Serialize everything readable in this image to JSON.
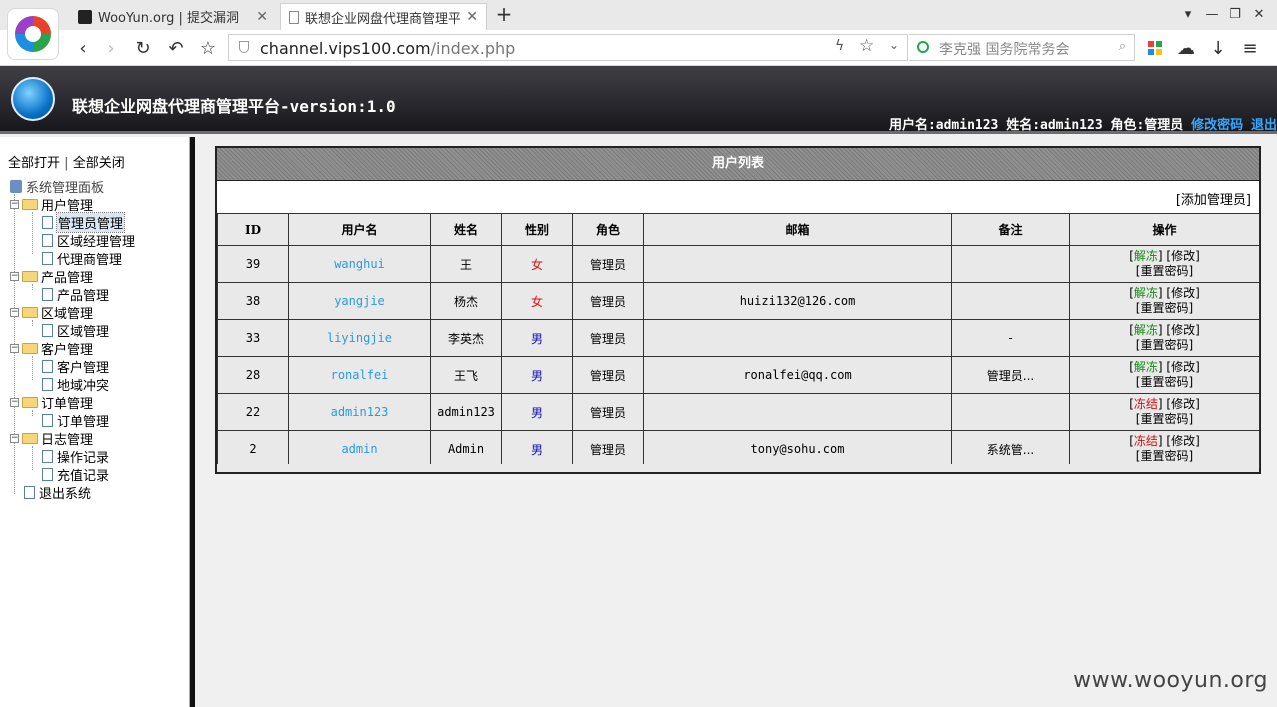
{
  "browser": {
    "tabs": [
      {
        "title": "WooYun.org | 提交漏洞"
      },
      {
        "title": "联想企业网盘代理商管理平台"
      }
    ],
    "url": {
      "host": "channel.vips100.com",
      "path": "/index.php"
    },
    "search_placeholder": "李克强 国务院常务会"
  },
  "header": {
    "title": "联想企业网盘代理商管理平台-version:1.0",
    "user_info": "用户名:admin123 姓名:admin123 角色:管理员",
    "change_password": "修改密码",
    "logout": "退出"
  },
  "sidebar": {
    "open_all": "全部打开",
    "close_all": "全部关闭",
    "separator": "|",
    "root": "系统管理面板",
    "groups": [
      {
        "label": "用户管理",
        "items": [
          "管理员管理",
          "区域经理管理",
          "代理商管理"
        ]
      },
      {
        "label": "产品管理",
        "items": [
          "产品管理"
        ]
      },
      {
        "label": "区域管理",
        "items": [
          "区域管理"
        ]
      },
      {
        "label": "客户管理",
        "items": [
          "客户管理",
          "地域冲突"
        ]
      },
      {
        "label": "订单管理",
        "items": [
          "订单管理"
        ]
      },
      {
        "label": "日志管理",
        "items": [
          "操作记录",
          "充值记录"
        ]
      }
    ],
    "logout": "退出系统"
  },
  "main": {
    "panel_title": "用户列表",
    "add_admin": "[添加管理员]",
    "columns": [
      "ID",
      "用户名",
      "姓名",
      "性别",
      "角色",
      "邮箱",
      "备注",
      "操作"
    ],
    "rows": [
      {
        "id": "39",
        "username": "wanghui",
        "name": "王",
        "gender": "女",
        "role": "管理员",
        "email": "",
        "note": "",
        "status_action": "解冻"
      },
      {
        "id": "38",
        "username": "yangjie",
        "name": "杨杰",
        "gender": "女",
        "role": "管理员",
        "email": "huizi132@126.com",
        "note": "",
        "status_action": "解冻"
      },
      {
        "id": "33",
        "username": "liyingjie",
        "name": "李英杰",
        "gender": "男",
        "role": "管理员",
        "email": "",
        "note": "-",
        "status_action": "解冻"
      },
      {
        "id": "28",
        "username": "ronalfei",
        "name": "王飞",
        "gender": "男",
        "role": "管理员",
        "email": "ronalfei@qq.com",
        "note": "管理员...",
        "status_action": "解冻"
      },
      {
        "id": "22",
        "username": "admin123",
        "name": "admin123",
        "gender": "男",
        "role": "管理员",
        "email": "",
        "note": "",
        "status_action": "冻结"
      },
      {
        "id": "2",
        "username": "admin",
        "name": "Admin",
        "gender": "男",
        "role": "管理员",
        "email": "tony@sohu.com",
        "note": "系统管...",
        "status_action": "冻结"
      }
    ],
    "op_edit": "修改",
    "op_reset": "重置密码"
  },
  "watermark": "www.wooyun.org"
}
